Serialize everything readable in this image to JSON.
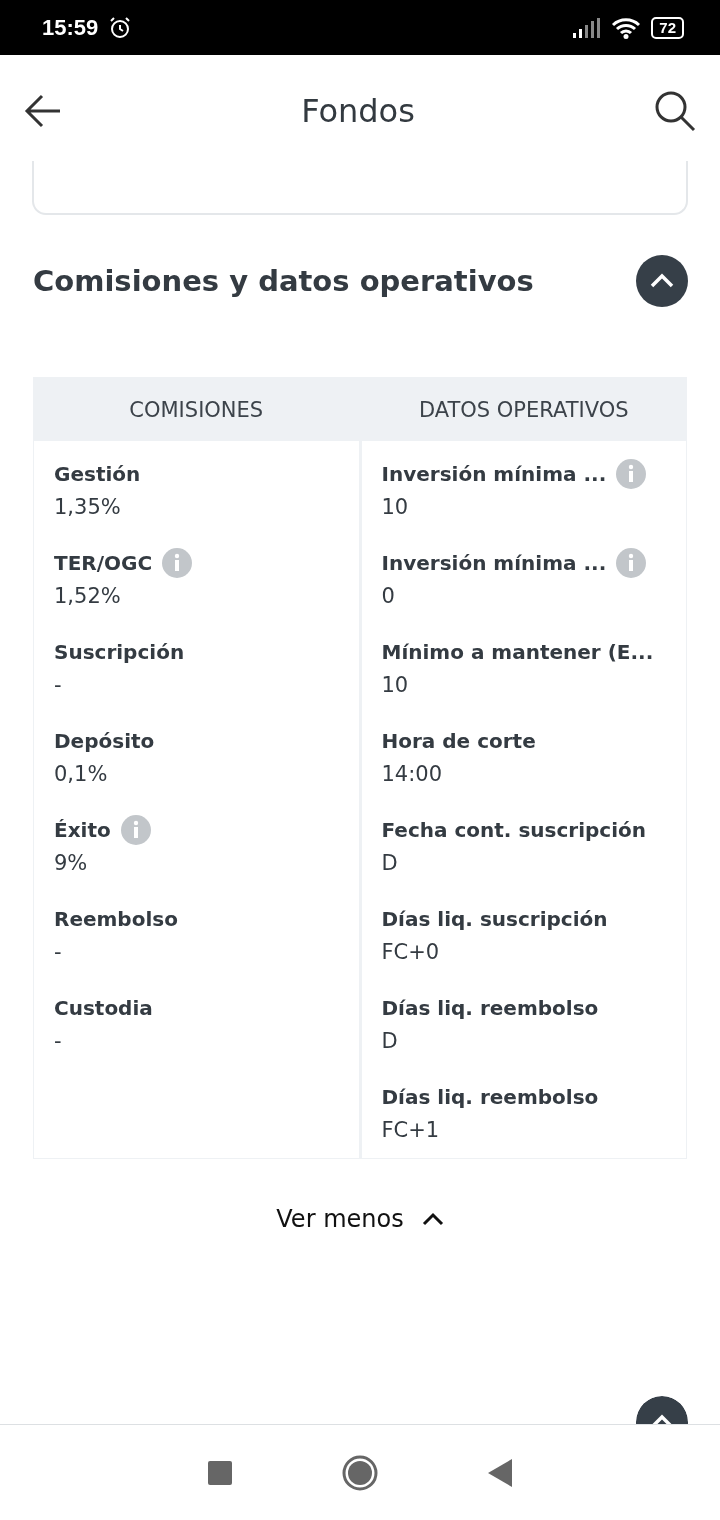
{
  "status_bar": {
    "time": "15:59",
    "battery": "72"
  },
  "header": {
    "title": "Fondos"
  },
  "section": {
    "title": "Comisiones y datos operativos",
    "expanded": true
  },
  "table": {
    "columns": [
      {
        "heading": "COMISIONES",
        "items": [
          {
            "label": "Gestión",
            "value": "1,35%",
            "info": false
          },
          {
            "label": "TER/OGC",
            "value": "1,52%",
            "info": true
          },
          {
            "label": "Suscripción",
            "value": "-",
            "info": false
          },
          {
            "label": "Depósito",
            "value": "0,1%",
            "info": false
          },
          {
            "label": "Éxito",
            "value": "9%",
            "info": true
          },
          {
            "label": "Reembolso",
            "value": "-",
            "info": false
          },
          {
            "label": "Custodia",
            "value": "-",
            "info": false
          }
        ]
      },
      {
        "heading": "DATOS OPERATIVOS",
        "items": [
          {
            "label": "Inversión mínima ...",
            "value": "10",
            "info": true
          },
          {
            "label": "Inversión mínima ...",
            "value": "0",
            "info": true
          },
          {
            "label": "Mínimo a mantener (E...",
            "value": "10",
            "info": false
          },
          {
            "label": "Hora de corte",
            "value": "14:00",
            "info": false
          },
          {
            "label": "Fecha cont. suscripción",
            "value": "D",
            "info": false
          },
          {
            "label": "Días liq. suscripción",
            "value": "FC+0",
            "info": false
          },
          {
            "label": "Días liq. reembolso",
            "value": "D",
            "info": false
          },
          {
            "label": "Días liq. reembolso",
            "value": "FC+1",
            "info": false
          }
        ]
      }
    ]
  },
  "toggle": {
    "label": "Ver menos"
  },
  "next_section": {
    "expanded": true
  }
}
